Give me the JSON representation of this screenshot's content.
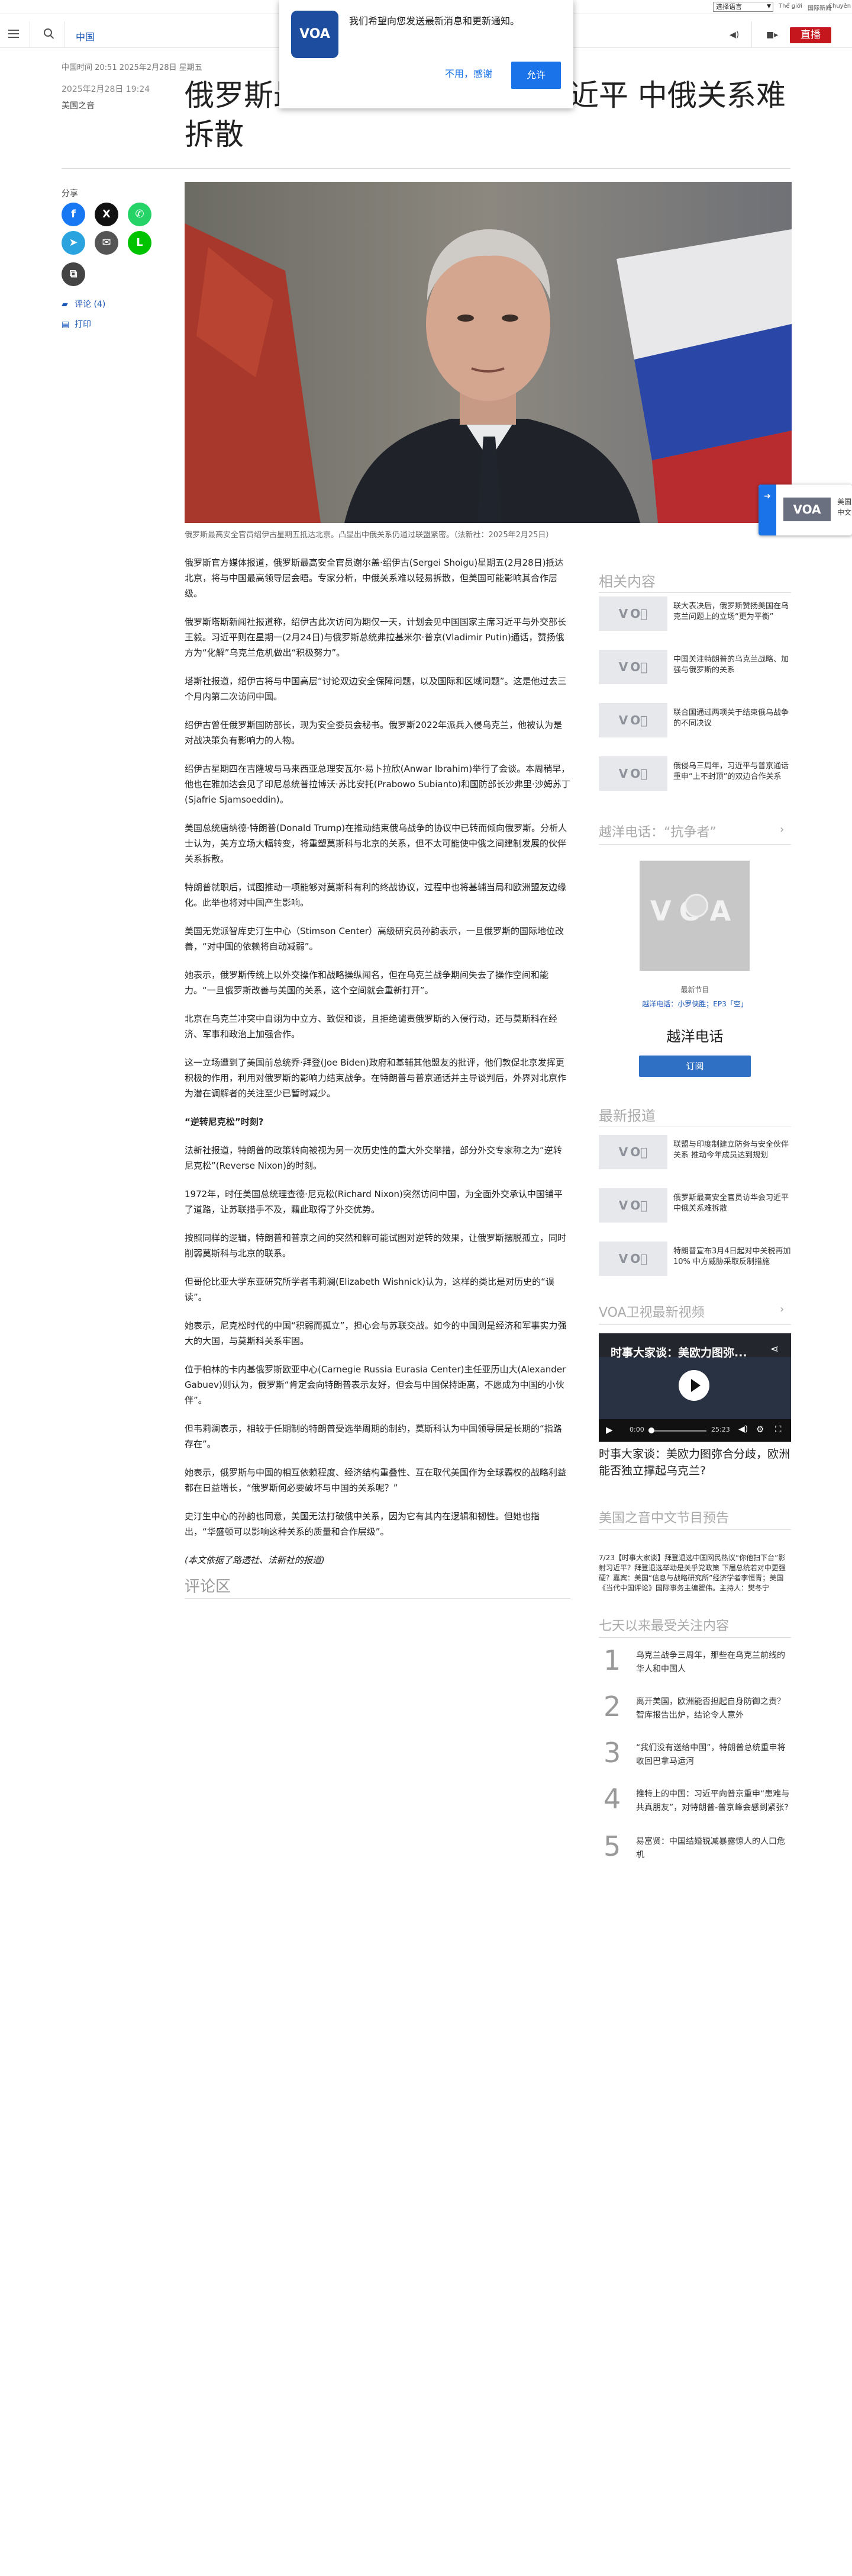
{
  "topbar": {
    "language_select": "选择语言",
    "links": [
      "Thể giới",
      "国际新闻",
      "Chuyên mục"
    ]
  },
  "header": {
    "section": "中国",
    "live_label": "直播"
  },
  "popup": {
    "logo_text": "VOA",
    "message": "我们希望向您发送最新消息和更新通知。",
    "deny_label": "不用，感谢",
    "allow_label": "允许"
  },
  "article_meta": {
    "published_line": "中国时间 20:51 2025年2月28日 星期五",
    "date": "2025年2月28日 19:24",
    "category": "美国之音"
  },
  "headline": "俄罗斯最高安全官员访华会习近平 中俄关系难拆散",
  "share": {
    "label": "分享",
    "buttons": [
      {
        "name": "facebook",
        "glyph": "f",
        "color": "#1877f2"
      },
      {
        "name": "x",
        "glyph": "X",
        "color": "#111111"
      },
      {
        "name": "whatsapp",
        "glyph": "✆",
        "color": "#25d366"
      },
      {
        "name": "telegram",
        "glyph": "➤",
        "color": "#2aa3df"
      },
      {
        "name": "email",
        "glyph": "✉",
        "color": "#555555"
      },
      {
        "name": "line",
        "glyph": "L",
        "color": "#00c300"
      },
      {
        "name": "copy-link",
        "glyph": "⧉",
        "color": "#444444"
      }
    ],
    "comments_label": "评论 (4)",
    "print_label": "打印"
  },
  "hero": {
    "caption": "俄罗斯最高安全官员绍伊古星期五抵达北京。凸显出中俄关系仍通过联盟紧密。（法新社：2025年2月25日）"
  },
  "side_widget": {
    "logo_text": "VOA",
    "text": "美国之音\n中文网"
  },
  "article": {
    "paragraphs": [
      {
        "style": "",
        "text": "俄罗斯官方媒体报道，俄罗斯最高安全官员谢尔盖·绍伊古(Sergei Shoigu)星期五(2月28日)抵达北京，将与中国最高领导层会晤。专家分析，中俄关系难以轻易拆散，但美国可能影响其合作层级。"
      },
      {
        "style": "",
        "text": "俄罗斯塔斯新闻社报道称，绍伊古此次访问为期仅一天，计划会见中国国家主席习近平与外交部长王毅。习近平则在星期一(2月24日)与俄罗斯总统弗拉基米尔·普京(Vladimir Putin)通话，赞扬俄方为“化解”乌克兰危机做出“积极努力”。"
      },
      {
        "style": "",
        "text": "塔斯社报道，绍伊古将与中国高层“讨论双边安全保障问题，以及国际和区域问题”。这是他过去三个月内第二次访问中国。"
      },
      {
        "style": "",
        "text": "绍伊古曾任俄罗斯国防部长，现为安全委员会秘书。俄罗斯2022年派兵入侵乌克兰，他被认为是对战决策负有影响力的人物。"
      },
      {
        "style": "",
        "text": "绍伊古星期四在吉隆坡与马来西亚总理安瓦尔·易卜拉欣(Anwar Ibrahim)举行了会谈。本周稍早，他也在雅加达会见了印尼总统普拉博沃·苏比安托(Prabowo Subianto)和国防部长沙弗里·沙姆苏丁(Sjafrie Sjamsoeddin)。"
      },
      {
        "style": "",
        "text": "美国总统唐纳德·特朗普(Donald Trump)在推动结束俄乌战争的协议中已转而倾向俄罗斯。分析人士认为，美方立场大幅转变，将重塑莫斯科与北京的关系，但不太可能使中俄之间建制发展的伙伴关系拆散。"
      },
      {
        "style": "",
        "text": "特朗普就职后，试图推动一项能够对莫斯科有利的终战协议，过程中也将基辅当局和欧洲盟友边缘化。此举也将对中国产生影响。"
      },
      {
        "style": "",
        "text": "美国无党派智库史汀生中心（Stimson Center）高级研究员孙韵表示，一旦俄罗斯的国际地位改善，“对中国的依赖将自动减弱”。"
      },
      {
        "style": "",
        "text": "她表示，俄罗斯传统上以外交操作和战略操纵闻名，但在乌克兰战争期间失去了操作空间和能力。“一旦俄罗斯改善与美国的关系，这个空间就会重新打开”。"
      },
      {
        "style": "",
        "text": "北京在乌克兰冲突中自诩为中立方、致促和谈，且拒绝谴责俄罗斯的入侵行动，还与莫斯科在经济、军事和政治上加强合作。"
      },
      {
        "style": "",
        "text": "这一立场遭到了美国前总统乔·拜登(Joe Biden)政府和基辅其他盟友的批评，他们敦促北京发挥更积极的作用，利用对俄罗斯的影响力结束战争。在特朗普与普京通话并主导谈判后，外界对北京作为潜在调解者的关注至少已暂时减少。"
      },
      {
        "style": "b",
        "text": "“逆转尼克松”时刻?"
      },
      {
        "style": "",
        "text": "法新社报道，特朗普的政策转向被视为另一次历史性的重大外交举措，部分外交专家称之为“逆转尼克松”(Reverse Nixon)的时刻。"
      },
      {
        "style": "",
        "text": "1972年，时任美国总统理查德·尼克松(Richard Nixon)突然访问中国，为全面外交承认中国铺平了道路，让苏联措手不及，藉此取得了外交优势。"
      },
      {
        "style": "",
        "text": "按照同样的逻辑，特朗普和普京之间的突然和解可能试图对逆转的效果，让俄罗斯摆脱孤立，同时削弱莫斯科与北京的联系。"
      },
      {
        "style": "",
        "text": "但哥伦比亚大学东亚研究所学者韦莉澜(Elizabeth Wishnick)认为，这样的类比是对历史的“误读”。"
      },
      {
        "style": "",
        "text": "她表示，尼克松时代的中国“积弱而孤立”，担心会与苏联交战。如今的中国则是经济和军事实力强大的大国，与莫斯科关系牢固。"
      },
      {
        "style": "",
        "text": "位于柏林的卡内基俄罗斯欧亚中心(Carnegie Russia Eurasia Center)主任亚历山大(Alexander Gabuev)则认为，俄罗斯“肯定会向特朗普表示友好，但会与中国保持距离，不愿成为中国的小伙伴”。"
      },
      {
        "style": "",
        "text": "但韦莉澜表示，相较于任期制的特朗普受选举周期的制约，莫斯科认为中国领导层是长期的“指路存在”。"
      },
      {
        "style": "",
        "text": "她表示，俄罗斯与中国的相互依赖程度、经济结构重叠性、互在取代美国作为全球霸权的战略利益都在日益增长，“俄罗斯何必要破坏与中国的关系呢？”"
      },
      {
        "style": "",
        "text": "史汀生中心的孙韵也同意，美国无法打破俄中关系，因为它有其内在逻辑和韧性。但她也指出，“华盛顿可以影响这种关系的质量和合作层级”。"
      },
      {
        "style": "i",
        "text": "(本文依据了路透社、法新社的报道)"
      }
    ]
  },
  "comments": {
    "title": "评论区"
  },
  "sidebar": {
    "related_title": "相关内容",
    "related": [
      "联大表决后，俄罗斯赞扬美国在乌克兰问题上的立场“更为平衡”",
      "中国关注特朗普的乌克兰战略、加强与俄罗斯的关系",
      "联合国通过两项关于结束俄乌战争的不同决议",
      "俄侵乌三周年，习近平与普京通话 重申“上不封顶”的双边合作关系"
    ],
    "radio_title": "越洋电话：“抗争者”",
    "radio_logo": "VOA",
    "radio_meta_1": "最新节目",
    "radio_meta_2": "越洋电话：小罗侠胜；EP3「空」",
    "radio_show": "越洋电话",
    "subscribe_label": "订阅",
    "latest_title": "最新报道",
    "latest": [
      "联盟与印度制建立防务与安全伙伴关系 推动今年成员达到规划",
      "俄罗斯最高安全官员访华会习近平 中俄关系难拆散",
      "特朗普宣布3月4日起对中关税再加10% 中方威胁采取反制措施"
    ],
    "video_section_title": "VOA卫视最新视频",
    "video": {
      "title": "时事大家谈：美欧力图弥...",
      "time_current": "0:00",
      "time_total": "25:23",
      "caption": "时事大家谈：美欧力图弥合分歧，欧洲能否独立撑起乌克兰?"
    },
    "preview_title": "美国之音中文节目预告",
    "preview_text": "7/23【时事大家谈】拜登退选中国网民热议“你他扫下台”影射习近平？拜登退选举动是关乎党政策 下届总统若对中更强硬？嘉宾：美国“信息与战略研究所”经济学者李恒青；美国《当代中国评论》国际事务主编翟伟。主持人：樊冬宁",
    "top7_title": "七天以来最受关注内容",
    "top7": [
      {
        "num": "1",
        "text": "乌克兰战争三周年，那些在乌克兰前线的华人和中国人"
      },
      {
        "num": "2",
        "text": "离开美国，欧洲能否担起自身防御之责？智库报告出炉，结论令人意外"
      },
      {
        "num": "3",
        "text": "“我们没有送给中国”，特朗普总统重申将收回巴拿马运河"
      },
      {
        "num": "4",
        "text": "推特上的中国：习近平向普京重申“患难与共真朋友”，对特朗普-普京峰会感到紧张?"
      },
      {
        "num": "5",
        "text": "易富贤：中国结婚锐减暴露惊人的人口危机"
      }
    ]
  },
  "colors": {
    "accent": "#1a56b6",
    "live": "#c4161c",
    "button_blue": "#1a73e8"
  }
}
